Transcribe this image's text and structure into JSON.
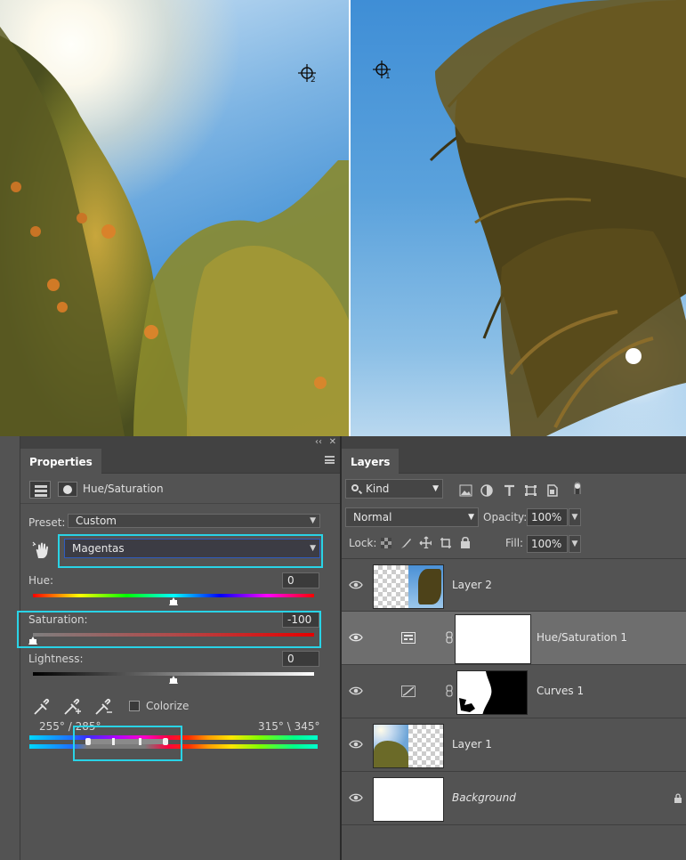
{
  "canvas": {
    "sampler_left": "2",
    "sampler_right": "1"
  },
  "properties": {
    "tab_label": "Properties",
    "adjustment_title": "Hue/Saturation",
    "preset_label": "Preset:",
    "preset_value": "Custom",
    "channel_value": "Magentas",
    "hue_label": "Hue:",
    "hue_value": "0",
    "hue_level": 0,
    "saturation_label": "Saturation:",
    "saturation_value": "-100",
    "saturation_level": -100,
    "lightness_label": "Lightness:",
    "lightness_value": "0",
    "lightness_level": 0,
    "colorize_label": "Colorize",
    "colorize_checked": false,
    "range_left_text": "255° / 285°",
    "range_right_text": "315° \\ 345°"
  },
  "layers": {
    "tab_label": "Layers",
    "kind_value": "Kind",
    "blend_mode": "Normal",
    "opacity_label": "Opacity:",
    "opacity_value": "100%",
    "lock_label": "Lock:",
    "fill_label": "Fill:",
    "fill_value": "100%",
    "items": [
      {
        "name": "Layer 2",
        "type": "pixel",
        "selected": false
      },
      {
        "name": "Hue/Saturation 1",
        "type": "adjustment",
        "selected": true
      },
      {
        "name": "Curves 1",
        "type": "adjustment",
        "selected": false
      },
      {
        "name": "Layer 1",
        "type": "pixel",
        "selected": false
      },
      {
        "name": "Background",
        "type": "background",
        "selected": false,
        "locked": true
      }
    ]
  },
  "colors": {
    "highlight": "#29d3e6",
    "panel_bg": "#535353",
    "selected_row": "#6e6e6e"
  }
}
